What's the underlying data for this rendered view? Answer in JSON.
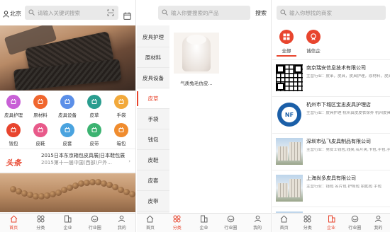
{
  "panel_home": {
    "location": "北京",
    "search_placeholder": "请输入关键词搜索",
    "categories": [
      {
        "label": "皮具护理",
        "color": "#c860d6",
        "icon": "brush-icon"
      },
      {
        "label": "原材料",
        "color": "#f0662e",
        "icon": "material-icon"
      },
      {
        "label": "皮具设备",
        "color": "#5b8fe8",
        "icon": "machine-icon"
      },
      {
        "label": "皮草",
        "color": "#2a9d8f",
        "icon": "fur-icon"
      },
      {
        "label": "手袋",
        "color": "#f2a93b",
        "icon": "handbag-icon"
      },
      {
        "label": "钱包",
        "color": "#e8452e",
        "icon": "wallet-icon"
      },
      {
        "label": "皮鞋",
        "color": "#e85a8a",
        "icon": "shoe-icon"
      },
      {
        "label": "皮套",
        "color": "#4aa3df",
        "icon": "case-icon"
      },
      {
        "label": "皮带",
        "color": "#3cb371",
        "icon": "belt-icon"
      },
      {
        "label": "箱包",
        "color": "#f08c2e",
        "icon": "luggage-icon"
      }
    ],
    "headline_logo": "头条",
    "news": [
      "2015日本东京箱包皮具展|日本鞋包展",
      "2015第十一届中国(西部)户外..."
    ]
  },
  "panel_category": {
    "search_placeholder": "输入你要搜索的产品",
    "search_button": "搜索",
    "side_items": [
      "皮具护理",
      "原材料",
      "皮具设备",
      "皮草",
      "手袋",
      "钱包",
      "皮鞋",
      "皮套",
      "皮带"
    ],
    "active_index": 3,
    "product_name": "气质兔毛仿皮..."
  },
  "panel_company": {
    "search_placeholder": "输入你想找的商家",
    "filters": [
      {
        "label": "全部",
        "icon": "grid-icon"
      },
      {
        "label": "诚信企",
        "icon": "badge-icon"
      }
    ],
    "companies": [
      {
        "name": "南京瑞安信息技术有限公司",
        "desc": "主营行业：皮革，皮具，皮具护理，原材料，皮具设备，皮带，皮鞋..."
      },
      {
        "name": "杭州市下城区宝忠皮具护理店",
        "desc": "主营行业：皮具护理 杭州真皮皮衣保养 杭州皮具护理 杭州皮具保养 杭州皮草护理"
      },
      {
        "name": "深圳市弘飞皮具制品有限公司",
        "desc": "主营行业：男女士钱包,钱夹,名片夹,卡包,手包,手包,手袋"
      },
      {
        "name": "上海尚多皮具有限公司",
        "desc": "主营行业：钱包 名片包 护照包 钥匙包 手包"
      },
      {
        "name": "",
        "desc": ""
      }
    ]
  },
  "tabbar": {
    "items": [
      {
        "label": "首页",
        "icon": "home-icon"
      },
      {
        "label": "分类",
        "icon": "category-icon"
      },
      {
        "label": "企业",
        "icon": "company-icon"
      },
      {
        "label": "行业圈",
        "icon": "circle-icon"
      },
      {
        "label": "我的",
        "icon": "user-icon"
      }
    ]
  },
  "colors": {
    "accent": "#e8452e",
    "search_bg": "#e9e9e9",
    "sidebar_bg": "#f4f4f4"
  }
}
